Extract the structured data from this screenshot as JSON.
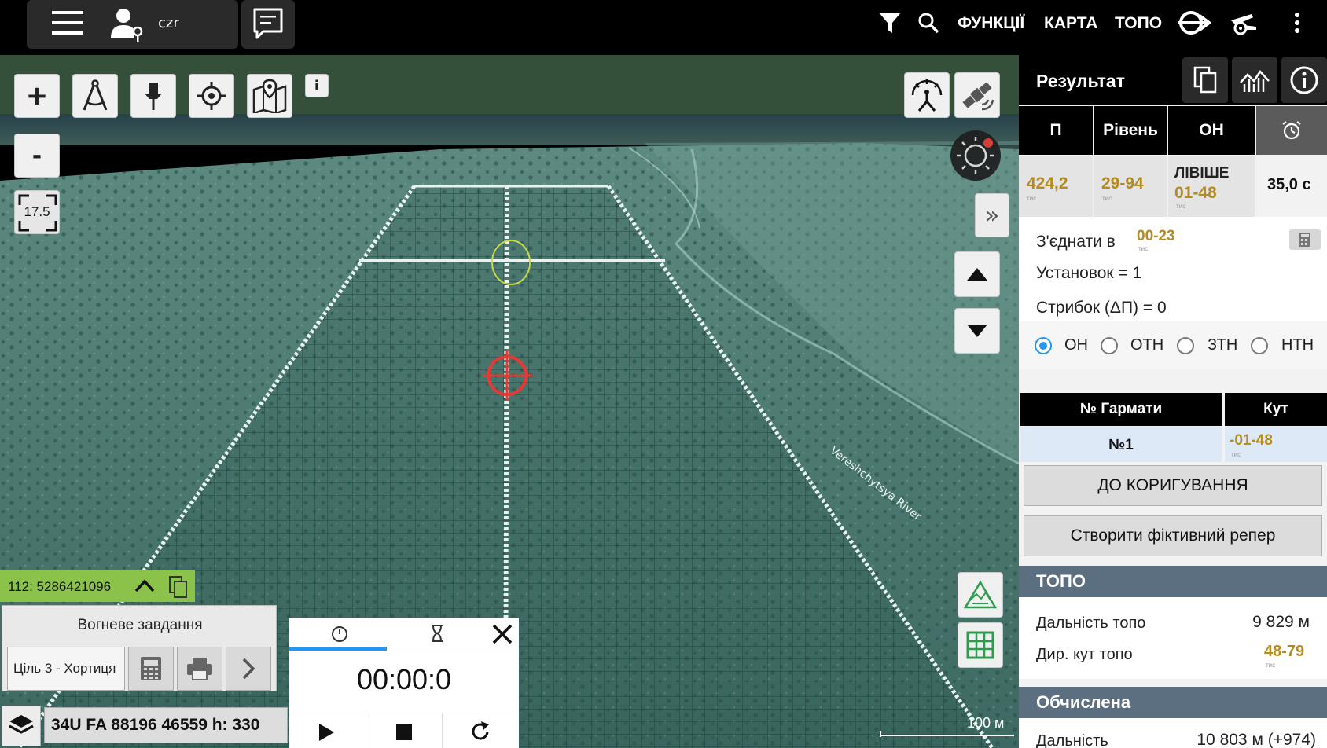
{
  "topbar": {
    "user_name": "czr",
    "menu_functions": "ФУНКЦІЇ",
    "menu_map": "КАРТА",
    "menu_topo": "ТОПО"
  },
  "map": {
    "zoom_in": "+",
    "zoom_out": "-",
    "zoom_level": "17.5",
    "info_label": "i",
    "expand_label": "»",
    "scale_label": "100 м",
    "river_label": "Vereshchytsya River",
    "status_code": "112: 5286421096",
    "fire_task_title": "Вогневе завдання",
    "target_label": "Ціль 3 - Хортиця",
    "coordinates": "34U FA 88196 46559 h: 330"
  },
  "timer": {
    "value": "00:00:0"
  },
  "panel": {
    "title": "Результат",
    "tabs": [
      "П",
      "Рівень",
      "ОН"
    ],
    "values": {
      "p_value": "424,2",
      "p_unit": "тис",
      "level_value": "29-94",
      "level_unit": "тис",
      "on_label": "ЛІВІШЕ",
      "on_value": "01-48",
      "on_unit": "тис",
      "time_value": "35,0 с"
    },
    "join_label": "З'єднати в",
    "join_value": "00-23",
    "join_unit": "тис",
    "installs": "Установок = 1",
    "jump": "Стрибок (ΔП) = 0",
    "radios": [
      "ОН",
      "ОТН",
      "ЗТН",
      "НТН"
    ],
    "radio_selected": "ОН",
    "gun_header": "№ Гармати",
    "angle_header": "Кут",
    "gun_value": "№1",
    "angle_value": "-01-48",
    "angle_unit": "тис",
    "btn_correction": "ДО КОРИГУВАННЯ",
    "btn_fictive": "Створити фіктивний репер",
    "topo_header": "ТОПО",
    "topo_range_label": "Дальність топо",
    "topo_range_value": "9 829 м",
    "topo_dir_label": "Дир. кут топо",
    "topo_dir_value": "48-79",
    "topo_dir_unit": "тис",
    "calc_header": "Обчислена",
    "calc_range_label": "Дальність",
    "calc_range_value": "10 803 м (+974)"
  },
  "colors": {
    "accent_gold": "#b58a1e",
    "status_green": "#8bc34a",
    "section_header": "#5c6f80",
    "radio_blue": "#2196f3"
  }
}
